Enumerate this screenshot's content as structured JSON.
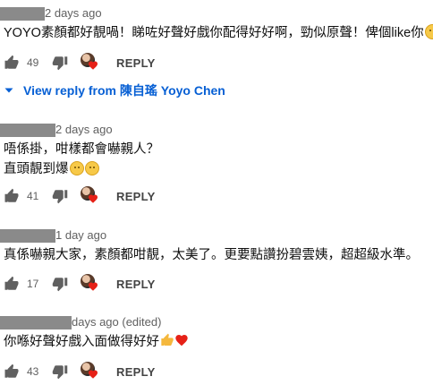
{
  "comments": [
    {
      "time": "2 days ago",
      "lines": [
        "YOYO素顏都好靚喎！睇咗好聲好戲你配得好好啊，勁似原聲！俾個like你"
      ],
      "likes": "49",
      "reply_label": "REPLY"
    },
    {
      "time": "2 days ago",
      "lines": [
        "唔係掛，咁樣都會嚇親人？",
        "直頭靚到爆"
      ],
      "likes": "41",
      "reply_label": "REPLY"
    },
    {
      "time": "1 day ago",
      "lines": [
        "真係嚇親大家，素顏都咁靚，太美了。更要點讚扮碧雲姨，超超級水準。"
      ],
      "likes": "17",
      "reply_label": "REPLY"
    },
    {
      "time": "days ago (edited)",
      "lines": [
        "你喺好聲好戲入面做得好好"
      ],
      "likes": "43",
      "reply_label": "REPLY"
    }
  ],
  "view_reply": {
    "label": "View reply from 陳自瑤 Yoyo Chen"
  },
  "colors": {
    "link": "#065fd4",
    "heart": "#e62117",
    "muted": "#606060"
  },
  "icons": [
    "thumb-up-icon",
    "thumb-down-icon",
    "heart-icon",
    "chevron-down-icon",
    "smile-emoji",
    "sad-emoji",
    "thumbs-up-emoji",
    "red-heart-emoji"
  ]
}
